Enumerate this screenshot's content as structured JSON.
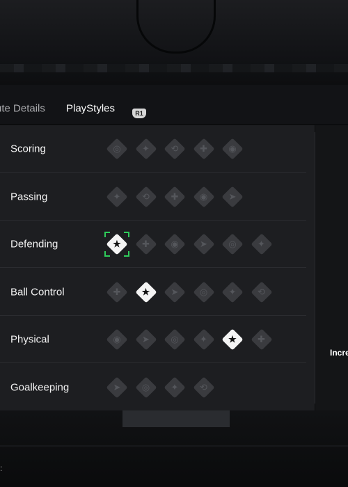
{
  "tabs": {
    "inactive_label": "ute Details",
    "active_label": "PlayStyles",
    "button_hint": "R1"
  },
  "right_pane": {
    "text": "Incre"
  },
  "bottom": {
    "stub_text": ":"
  },
  "categories": [
    {
      "label": "Scoring",
      "icons": [
        "finesse-shot-icon",
        "power-shot-icon",
        "chip-shot-icon",
        "precision-header-icon",
        "dead-ball-icon"
      ],
      "active": []
    },
    {
      "label": "Passing",
      "icons": [
        "incisive-pass-icon",
        "pinged-pass-icon",
        "long-ball-pass-icon",
        "tiki-taka-icon",
        "whipped-pass-icon"
      ],
      "active": []
    },
    {
      "label": "Defending",
      "icons": [
        "slide-tackle-icon",
        "jockey-icon",
        "block-icon",
        "intercept-icon",
        "anticipate-icon",
        "aerial-icon"
      ],
      "active": [
        0
      ],
      "selected": 0
    },
    {
      "label": "Ball Control",
      "icons": [
        "first-touch-icon",
        "flair-icon",
        "press-proven-icon",
        "rapid-icon",
        "technical-icon",
        "trickster-icon"
      ],
      "active": [
        1
      ]
    },
    {
      "label": "Physical",
      "icons": [
        "acrobatic-icon",
        "bruiser-icon",
        "long-throw-icon",
        "quick-step-icon",
        "relentless-icon",
        "trivela-icon"
      ],
      "active": [
        4
      ]
    },
    {
      "label": "Goalkeeping",
      "icons": [
        "far-throw-icon",
        "footwork-icon",
        "cross-claimer-icon",
        "rush-out-icon"
      ],
      "active": []
    }
  ],
  "glyphs": [
    "◎",
    "✦",
    "⟲",
    "✚",
    "◉",
    "➤"
  ]
}
